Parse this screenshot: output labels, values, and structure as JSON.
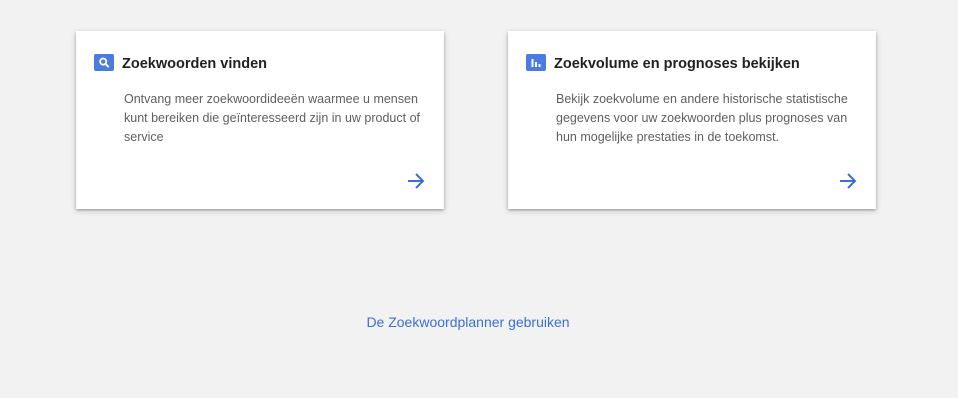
{
  "cards": [
    {
      "icon": "search-icon",
      "title": "Zoekwoorden vinden",
      "description": "Ontvang meer zoekwoordideeën waarmee u mensen kunt bereiken die geïnteresseerd zijn in uw product of service",
      "arrow_icon": "arrow-right-icon"
    },
    {
      "icon": "bar-chart-icon",
      "title": "Zoekvolume en prognoses bekijken",
      "description": "Bekijk zoekvolume en andere historische statistische gegevens voor uw zoekwoorden plus prognoses van hun mogelijke prestaties in de toekomst.",
      "arrow_icon": "arrow-right-icon"
    }
  ],
  "footer_link": {
    "label": "De Zoekwoordplanner gebruiken"
  },
  "colors": {
    "background": "#f2f2f2",
    "card_background": "#ffffff",
    "accent": "#4a7be0",
    "link": "#3a6fd8",
    "title": "#212121",
    "body_text": "#5f5f5f"
  }
}
